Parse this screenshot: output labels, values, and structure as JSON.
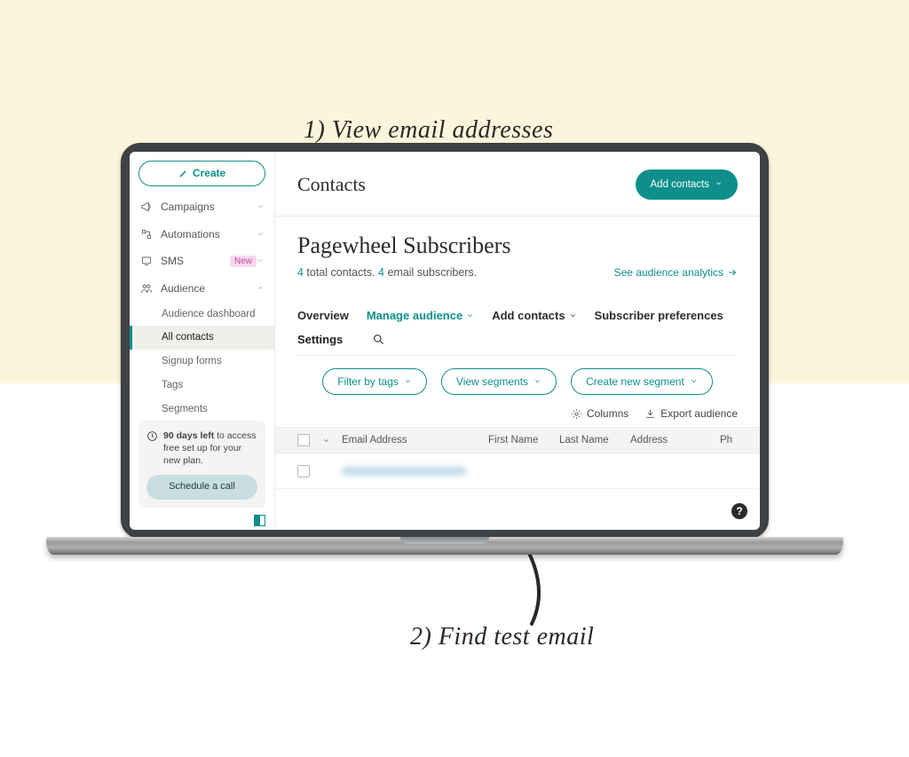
{
  "annotations": {
    "one": "1) View email addresses",
    "two": "2) Find test email"
  },
  "sidebar": {
    "create_label": "Create",
    "nav": [
      {
        "label": "Campaigns"
      },
      {
        "label": "Automations"
      },
      {
        "label": "SMS",
        "badge": "New"
      },
      {
        "label": "Audience"
      }
    ],
    "sub_items": [
      "Audience dashboard",
      "All contacts",
      "Signup forms",
      "Tags",
      "Segments"
    ],
    "promo_bold": "90 days left",
    "promo_rest": " to access free set up for your new plan.",
    "schedule_label": "Schedule a call"
  },
  "main": {
    "page_title": "Contacts",
    "add_contacts_btn": "Add contacts",
    "audience_title": "Pagewheel Subscribers",
    "stats_total": "4",
    "stats_total_label": " total contacts. ",
    "stats_subs": "4",
    "stats_subs_label": " email subscribers.",
    "see_analytics": "See audience analytics",
    "tabs": {
      "overview": "Overview",
      "manage": "Manage audience",
      "add": "Add contacts",
      "prefs": "Subscriber preferences",
      "settings": "Settings"
    },
    "pills": {
      "filter": "Filter by tags",
      "view": "View segments",
      "create": "Create new segment"
    },
    "toolbar": {
      "columns": "Columns",
      "export": "Export audience"
    },
    "columns": {
      "email": "Email Address",
      "first": "First Name",
      "last": "Last Name",
      "address": "Address",
      "phone": "Ph"
    },
    "help": "?"
  }
}
